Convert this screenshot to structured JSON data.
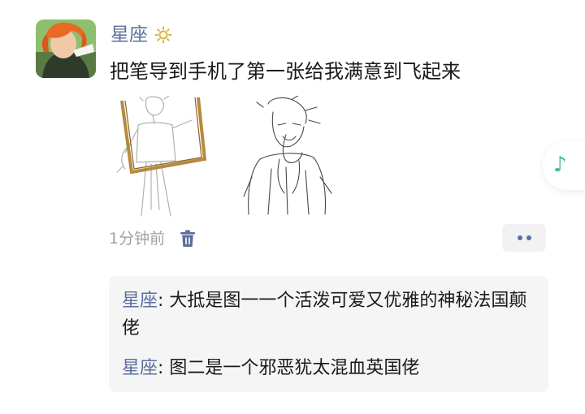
{
  "post": {
    "username": "星座",
    "text": "把笔导到手机了第一张给我满意到飞起来",
    "timestamp": "1分钟前",
    "images": [
      {
        "name": "sketch-figure-with-frame"
      },
      {
        "name": "sketch-figure-covering-mouth"
      }
    ]
  },
  "music_fab": {
    "glyph": "♪",
    "color": "#3fc08a"
  },
  "comments": [
    {
      "author": "星座",
      "sep": ": ",
      "text": "大抵是图一一个活泼可爱又优雅的神秘法国颠佬"
    },
    {
      "author": "星座",
      "sep": ": ",
      "text": "图二是一个邪恶犹太混血英国佬"
    }
  ],
  "colors": {
    "name": "#5b6f9c",
    "text": "#1a1a1a",
    "meta": "#a2a2a2",
    "comment_bg": "#f5f5f6"
  },
  "icons": {
    "badge": "sun-badge-icon",
    "delete": "trash-icon",
    "more": "more-dots-icon",
    "music": "music-note-icon"
  }
}
